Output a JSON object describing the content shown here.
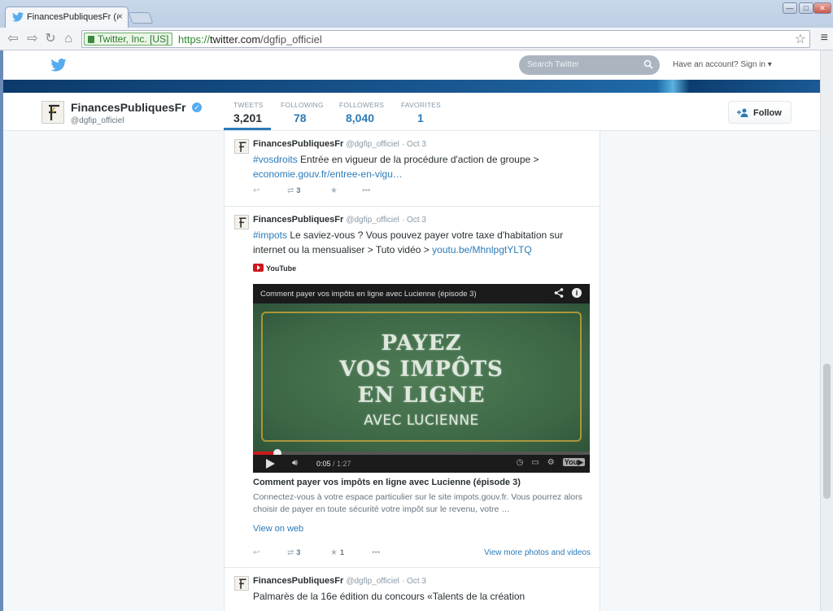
{
  "browser": {
    "tab_title": "FinancesPubliquesFr (@",
    "tab_close": "×",
    "ev_label": "Twitter, Inc. [US]",
    "url_scheme": "https://",
    "url_host": "twitter.com",
    "url_path": "/dgfip_officiel",
    "window_buttons": [
      "—",
      "□",
      "✕"
    ]
  },
  "topbar": {
    "search_placeholder": "Search Twitter",
    "signin": "Have an account? Sign in ▾"
  },
  "profile": {
    "name": "FinancesPubliquesFr",
    "handle": "@dgfip_officiel",
    "stats": [
      {
        "label": "TWEETS",
        "value": "3,201"
      },
      {
        "label": "FOLLOWING",
        "value": "78"
      },
      {
        "label": "FOLLOWERS",
        "value": "8,040"
      },
      {
        "label": "FAVORITES",
        "value": "1"
      }
    ],
    "follow_label": "Follow"
  },
  "tweets": [
    {
      "name": "FinancesPubliquesFr",
      "handle": "@dgfip_officiel",
      "date": "· Oct 3",
      "hashtag": "#vosdroits",
      "text": " Entrée en vigueur de la procédure d'action de groupe > ",
      "link": "economie.gouv.fr/entree-en-vigu…",
      "retweets": "3",
      "favorites": ""
    },
    {
      "name": "FinancesPubliquesFr",
      "handle": "@dgfip_officiel",
      "date": "· Oct 3",
      "hashtag": "#impots",
      "text": " Le saviez-vous ? Vous pouvez payer votre taxe d'habitation sur internet ou la mensualiser > Tuto vidéo > ",
      "link": "youtu.be/MhnlpgtYLTQ",
      "source": "YouTube",
      "video": {
        "title": "Comment payer vos impôts en ligne avec Lucienne (épisode 3)",
        "board_line1": "PAYEZ",
        "board_line2": "VOS IMPÔTS",
        "board_line3": "EN LIGNE",
        "board_line4": "AVEC LUCIENNE",
        "time_current": "0:05",
        "time_total": " / 1:27",
        "progress": 0.072
      },
      "card_title": "Comment payer vos impôts en ligne avec Lucienne (épisode 3)",
      "card_desc": "Connectez-vous à votre espace particulier sur le site impots.gouv.fr. Vous pourrez alors choisir de payer en toute sécurité votre impôt sur le revenu, votre …",
      "card_link": "View on web",
      "retweets": "3",
      "favorites": "1",
      "more_link": "View more photos and videos"
    },
    {
      "name": "FinancesPubliquesFr",
      "handle": "@dgfip_officiel",
      "date": "· Oct 3",
      "text": "Palmarès de la 16e édition du concours «Talents de la création"
    }
  ],
  "icons": {
    "reply": "reply-icon",
    "retweet": "retweet-icon",
    "favorite": "star-icon",
    "more": "more-icon"
  },
  "colors": {
    "link": "#2b7bb9",
    "verified": "#55acee",
    "youtube_red": "#cc181e"
  }
}
